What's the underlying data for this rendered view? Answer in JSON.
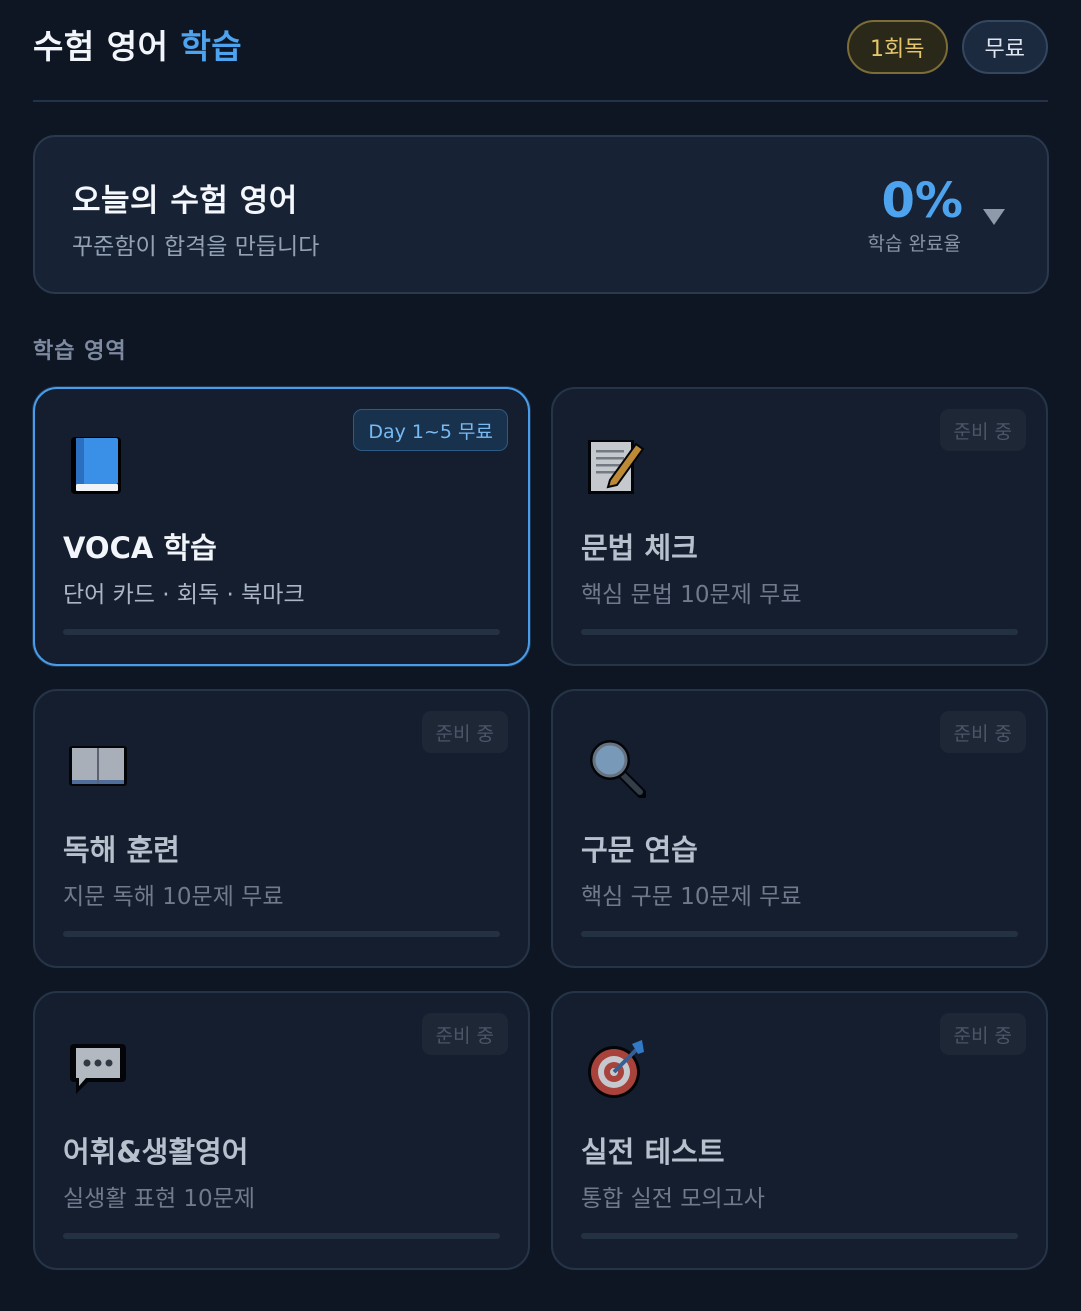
{
  "header": {
    "title": "수험 영어",
    "title_accent": "학습",
    "badge_round": "1회독",
    "badge_free": "무료"
  },
  "today": {
    "title": "오늘의 수험 영어",
    "subtitle": "꾸준함이 합격을 만듭니다",
    "percent": "0%",
    "percent_label": "학습 완료율"
  },
  "section_label": "학습 영역",
  "cards": [
    {
      "icon": "blue-book-icon",
      "title": "VOCA 학습",
      "subtitle": "단어 카드 · 회독 · 북마크",
      "badge": "Day 1~5 무료",
      "progress": 0
    },
    {
      "icon": "memo-pencil-icon",
      "title": "문법 체크",
      "subtitle": "핵심 문법 10문제 무료",
      "badge": "준비 중",
      "progress": 0
    },
    {
      "icon": "open-book-icon",
      "title": "독해 훈련",
      "subtitle": "지문 독해 10문제 무료",
      "badge": "준비 중",
      "progress": 0
    },
    {
      "icon": "magnifier-icon",
      "title": "구문 연습",
      "subtitle": "핵심 구문 10문제 무료",
      "badge": "준비 중",
      "progress": 0
    },
    {
      "icon": "speech-bubble-icon",
      "title": "어휘&생활영어",
      "subtitle": "실생활 표현 10문제",
      "badge": "준비 중",
      "progress": 0
    },
    {
      "icon": "target-icon",
      "title": "실전 테스트",
      "subtitle": "통합 실전 모의고사",
      "badge": "준비 중",
      "progress": 0
    }
  ]
}
